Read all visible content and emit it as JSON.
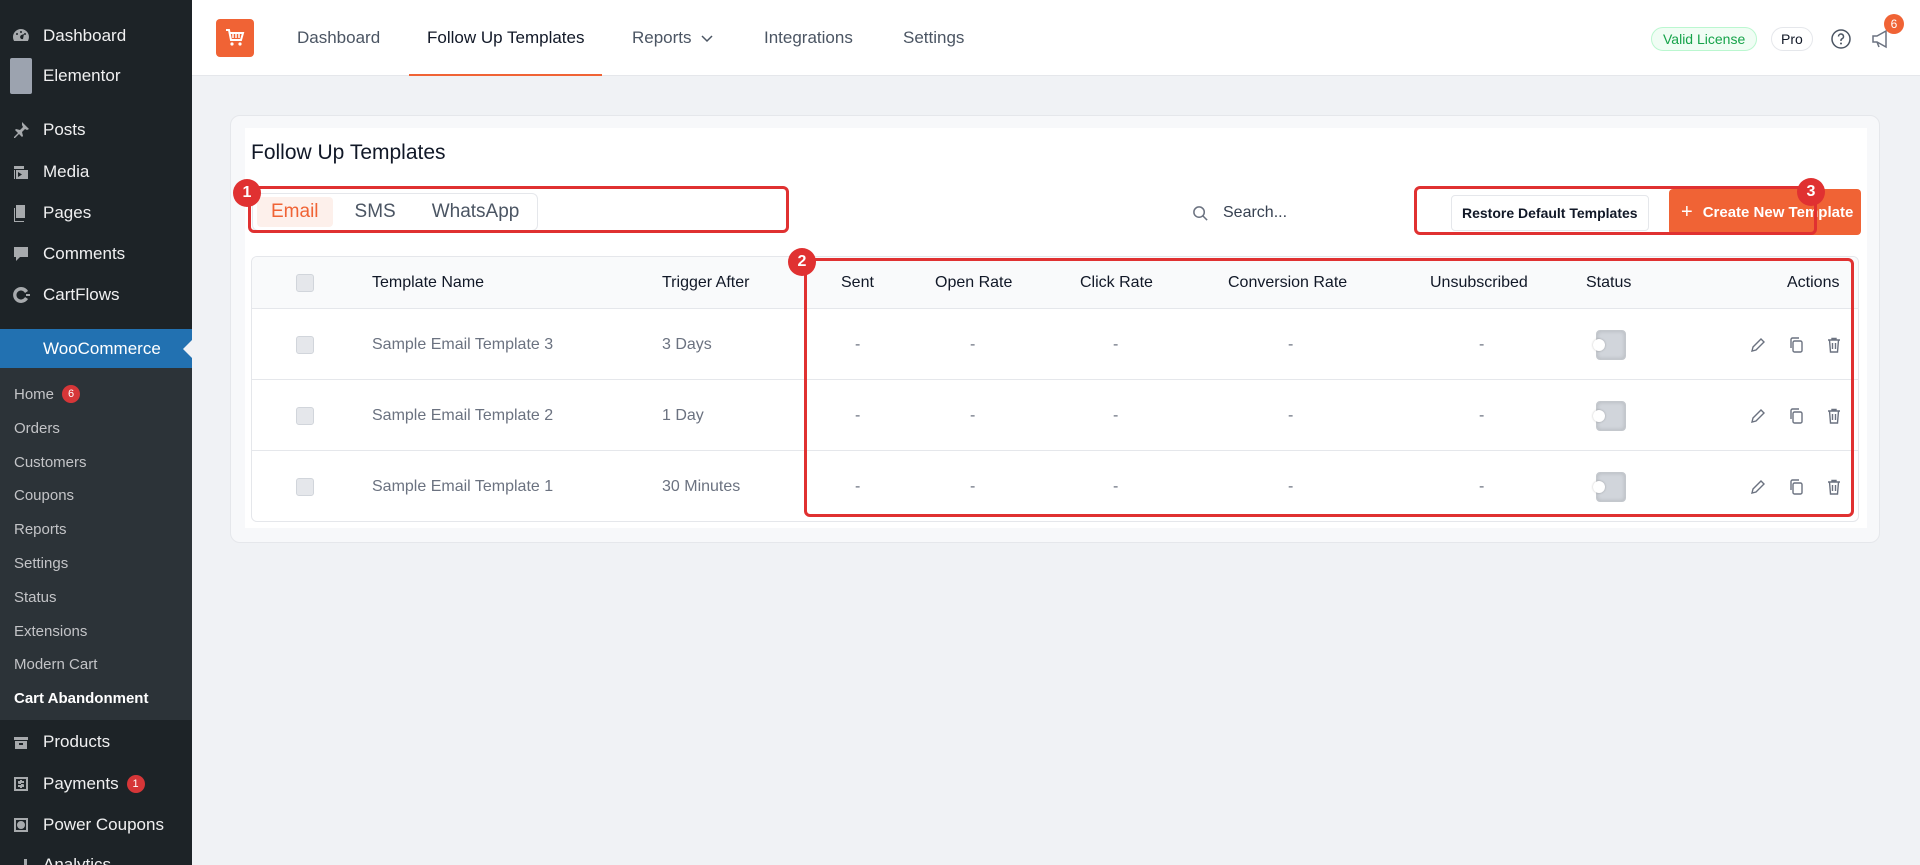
{
  "sidebar": {
    "top_items": [
      {
        "label": "Dashboard",
        "icon": "dashboard-icon"
      },
      {
        "label": "Elementor",
        "icon": "elementor-icon"
      },
      {
        "label": "Posts",
        "icon": "pin-icon"
      },
      {
        "label": "Media",
        "icon": "media-icon"
      },
      {
        "label": "Pages",
        "icon": "pages-icon"
      },
      {
        "label": "Comments",
        "icon": "comment-icon"
      },
      {
        "label": "CartFlows",
        "icon": "cartflows-icon"
      },
      {
        "label": "WooCommerce",
        "icon": "woo-icon"
      }
    ],
    "sub_items": [
      {
        "label": "Home",
        "badge": "6"
      },
      {
        "label": "Orders"
      },
      {
        "label": "Customers"
      },
      {
        "label": "Coupons"
      },
      {
        "label": "Reports"
      },
      {
        "label": "Settings"
      },
      {
        "label": "Status"
      },
      {
        "label": "Extensions"
      },
      {
        "label": "Modern Cart"
      },
      {
        "label": "Cart Abandonment"
      }
    ],
    "bottom_items": [
      {
        "label": "Products",
        "icon": "products-icon"
      },
      {
        "label": "Payments",
        "icon": "payments-icon",
        "badge": "1"
      },
      {
        "label": "Power Coupons",
        "icon": "power-coupons-icon"
      },
      {
        "label": "Analytics",
        "icon": "analytics-icon"
      }
    ]
  },
  "topnav": {
    "links": [
      "Dashboard",
      "Follow Up Templates",
      "Reports",
      "Integrations",
      "Settings"
    ],
    "license": "Valid License",
    "plan": "Pro",
    "notifications": "6",
    "accent": "#f06335"
  },
  "page": {
    "title": "Follow Up Templates",
    "tabs": [
      "Email",
      "SMS",
      "WhatsApp"
    ],
    "search_placeholder": "Search...",
    "restore_label": "Restore Default Templates",
    "create_label": "Create New Template"
  },
  "table": {
    "headers": [
      "Template Name",
      "Trigger After",
      "Sent",
      "Open Rate",
      "Click Rate",
      "Conversion Rate",
      "Unsubscribed",
      "Status",
      "Actions"
    ],
    "rows": [
      {
        "name": "Sample Email Template 3",
        "trigger": "3 Days",
        "sent": "-",
        "open": "-",
        "click": "-",
        "conversion": "-",
        "unsub": "-"
      },
      {
        "name": "Sample Email Template 2",
        "trigger": "1 Day",
        "sent": "-",
        "open": "-",
        "click": "-",
        "conversion": "-",
        "unsub": "-"
      },
      {
        "name": "Sample Email Template 1",
        "trigger": "30 Minutes",
        "sent": "-",
        "open": "-",
        "click": "-",
        "conversion": "-",
        "unsub": "-"
      }
    ]
  },
  "annotations": [
    "1",
    "2",
    "3"
  ]
}
